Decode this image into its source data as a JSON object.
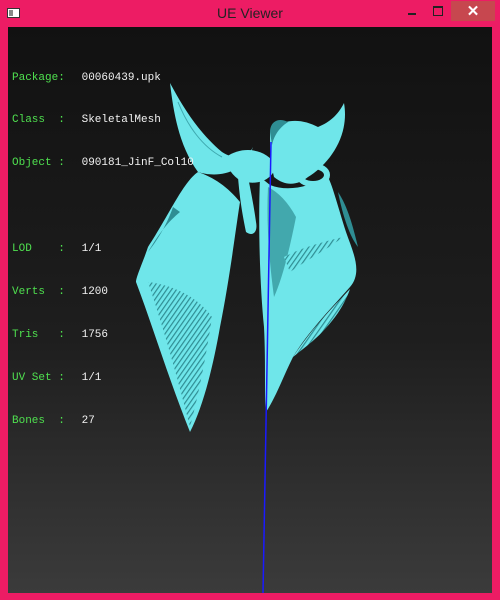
{
  "window": {
    "title": "UE Viewer",
    "frame_color": "#ed1c64",
    "close_button_color": "#c7474f",
    "controls": [
      "minimize-icon",
      "maximize-icon",
      "close-icon"
    ],
    "close_glyph": "✕"
  },
  "info": {
    "rows": [
      {
        "label": "Package:",
        "value": "00060439.upk"
      },
      {
        "label": "Class  :",
        "value": "SkeletalMesh"
      },
      {
        "label": "Object :",
        "value": "090181_JinF_Col10"
      }
    ],
    "stats": [
      {
        "label": "LOD    :",
        "value": "1/1"
      },
      {
        "label": "Verts  :",
        "value": "1200"
      },
      {
        "label": "Tris   :",
        "value": "1756"
      },
      {
        "label": "UV Set :",
        "value": "1/1"
      },
      {
        "label": "Bones  :",
        "value": "27"
      }
    ],
    "label_color": "#4fe04f",
    "value_color": "#f2f2f2"
  },
  "mesh": {
    "color": "#6fe6ea",
    "axis_color": "#1a1aff"
  }
}
